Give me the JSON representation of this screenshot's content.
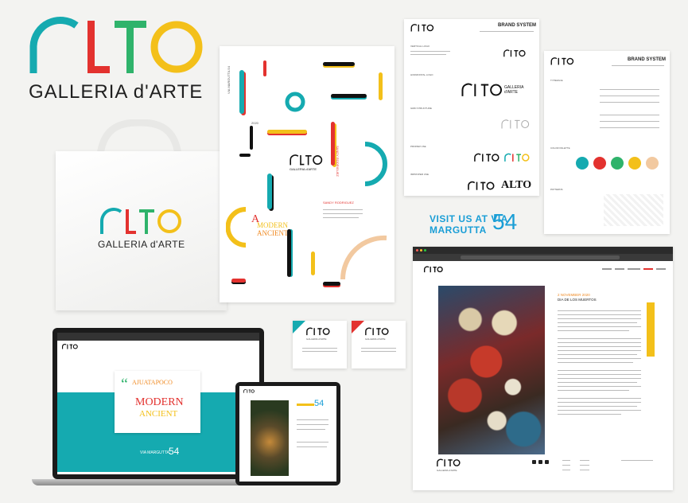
{
  "logo": {
    "mark": "ALTO",
    "subtitle": "GALLERIA d'ARTE"
  },
  "colors": {
    "teal": "#15aab0",
    "red": "#e3322f",
    "yellow": "#f3c01a",
    "green": "#2fb36b",
    "orange": "#f08b24",
    "peach": "#f2c9a0",
    "blue": "#1a9ed6"
  },
  "bag": {
    "mark": "ALTO",
    "subtitle": "GALLERIA d'ARTE"
  },
  "poster": {
    "mark": "ALTO",
    "subtitle": "GALLERIA d'ARTE",
    "quote_a": "A",
    "quote_b": "MODERN",
    "quote_c": "ANCIENT",
    "artist": "SANDY RODRIGUEZ",
    "address": "VIA MARGUTTA 54",
    "year": "2020"
  },
  "brand1": {
    "title": "BRAND SYSTEM",
    "mark": "ALTO",
    "subtitle": "GALLERIA d'ARTE",
    "wordmark": "ALTO",
    "labels": [
      "VERTICAL LOGO",
      "HORIZONTAL LOGO",
      "GRID STRUCTURE",
      "PROPER USE",
      "IMPROPER USE"
    ]
  },
  "brand2": {
    "title": "BRAND SYSTEM",
    "mark": "ALTO",
    "subtitle": "GALLERIA d'ARTE",
    "labels": [
      "TYPEFACE",
      "COLOR PALETTE",
      "PATTERNS"
    ]
  },
  "visit": {
    "line1": "VISIT US AT VIA",
    "line2": "MARGUTTA",
    "num": "54"
  },
  "cards": [
    {
      "mark": "ALTO",
      "subtitle": "GALLERIA d'ARTE"
    },
    {
      "mark": "ALTO",
      "subtitle": "GALLERIA d'ARTE"
    }
  ],
  "laptop": {
    "mark": "ALTO",
    "quote_a": "AJUATAPOCO",
    "quote_b": "MODERN",
    "quote_c": "ANCIENT",
    "address": "VIA MARGUTTA",
    "num": "54"
  },
  "tablet": {
    "mark": "ALTO",
    "num": "54"
  },
  "browser": {
    "mark": "ALTO",
    "event_date": "2 NOVEMBER 2020",
    "event_title": "DIA DE LOS MUERTOS",
    "footer_mark": "ALTO",
    "footer_sub": "GALLERIA d'ARTE"
  }
}
